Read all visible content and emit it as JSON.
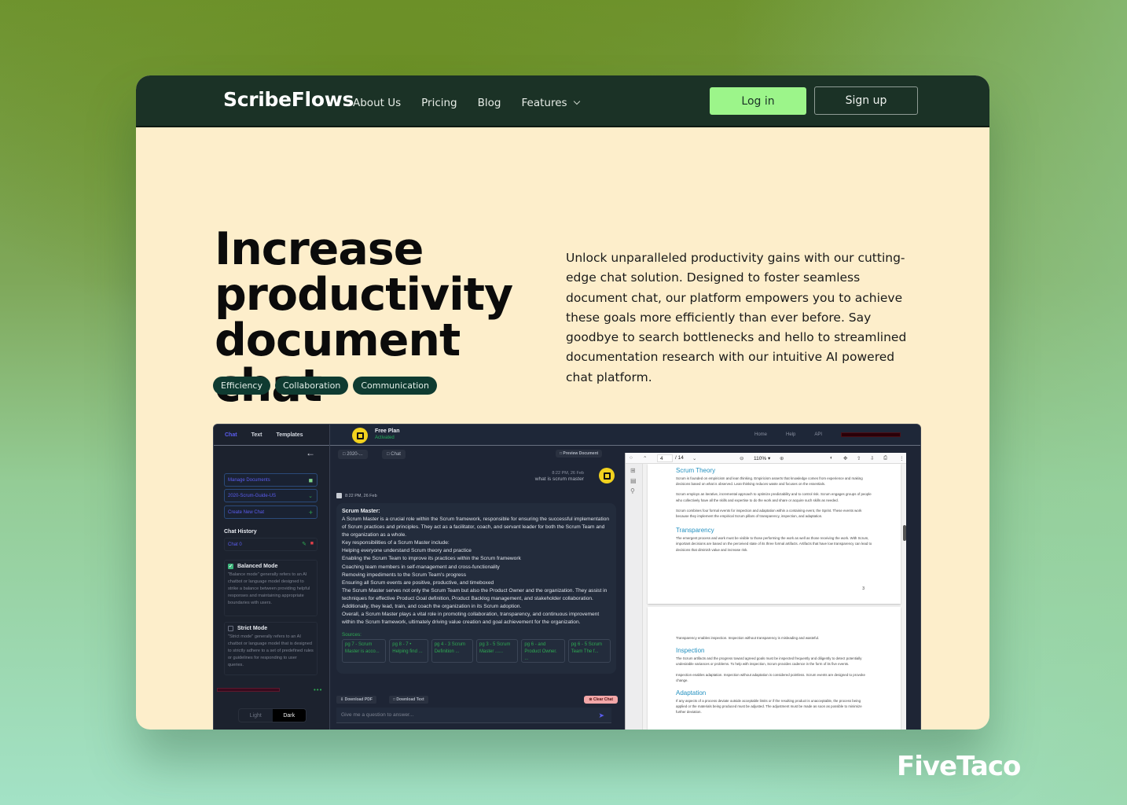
{
  "nav": {
    "logo": "ScribeFlows",
    "links": [
      "About Us",
      "Pricing",
      "Blog",
      "Features"
    ],
    "login": "Log in",
    "signup": "Sign up"
  },
  "hero": {
    "title_lines": [
      "Increase",
      "productivity",
      "document chat"
    ],
    "tags": [
      "Efficiency",
      "Collaboration",
      "Communication"
    ],
    "description": "Unlock unparalleled productivity gains with our cutting-edge chat solution. Designed to foster seamless document chat, our platform empowers you to achieve these goals more efficiently than ever before. Say goodbye to search bottlenecks and hello to streamlined documentation research with our intuitive AI powered chat platform."
  },
  "app": {
    "side_tabs": [
      "Chat",
      "Text",
      "Templates"
    ],
    "manage_documents": "Manage Documents",
    "selected_document": "2020-Scrum-Guide-US",
    "create_new_chat": "Create New Chat",
    "chat_history_title": "Chat History",
    "chat_items": [
      "Chat 0"
    ],
    "balanced_mode": {
      "title": "Balanced Mode",
      "checked": true,
      "text": "\"Balance mode\" generally refers to an AI chatbot or language model designed to strike a balance between providing helpful responses and maintaining appropriate boundaries with users."
    },
    "strict_mode": {
      "title": "Strict Mode",
      "checked": false,
      "text": "\"Strict mode\" generally refers to an AI chatbot or language model that is designed to strictly adhere to a set of predefined rules or guidelines for responding to user queries."
    },
    "theme_options": [
      "Light",
      "Dark"
    ],
    "theme_selected": "Dark",
    "plan_name": "Free Plan",
    "plan_status": "Activated",
    "top_links": [
      "Home",
      "Help",
      "API"
    ],
    "chips": [
      "2020-...",
      "Chat"
    ],
    "preview_document": "Preview Document",
    "user_message": {
      "time": "8:22 PM, 26 Feb",
      "text": "what is scrum master"
    },
    "bot_message": {
      "time": "8:22 PM, 26 Feb",
      "title": "Scrum Master:",
      "lines": [
        "A Scrum Master is a crucial role within the Scrum framework, responsible for ensuring the successful implementation of Scrum practices and principles. They act as a facilitator, coach, and servant leader for both the Scrum Team and the organization as a whole.",
        "Key responsibilities of a Scrum Master include:",
        "Helping everyone understand Scrum theory and practice",
        "Enabling the Scrum Team to improve its practices within the Scrum framework",
        "Coaching team members in self-management and cross-functionality",
        "Removing impediments to the Scrum Team's progress",
        "Ensuring all Scrum events are positive, productive, and timeboxed",
        "The Scrum Master serves not only the Scrum Team but also the Product Owner and the organization. They assist in techniques for effective Product Goal definition, Product Backlog management, and stakeholder collaboration. Additionally, they lead, train, and coach the organization in its Scrum adoption.",
        "Overall, a Scrum Master plays a vital role in promoting collaboration, transparency, and continuous improvement within the Scrum framework, ultimately driving value creation and goal achievement for the organization."
      ],
      "sources_label": "Sources:",
      "sources": [
        "pg 7 - Scrum Master is acco...",
        "pg 8 - 7 • Helping find ...",
        "pg 4 - 3 Scrum Definition ...",
        "pg 3 - 5 Scrum Master ......",
        "pg 6 - and Product Owner. ...",
        "pg 6 - 5 Scrum Team The f..."
      ]
    },
    "download_pdf": "Download PDF",
    "download_text": "Download Text",
    "clear_chat": "Clear Chat",
    "input_placeholder": "Give me a question to answer...",
    "pdf": {
      "current_page": "4",
      "total_pages": "/ 14",
      "zoom": "110% ▾",
      "page1": {
        "heading": "Scrum Theory",
        "paras": [
          "Scrum is founded on empiricism and lean thinking. Empiricism asserts that knowledge comes from experience and making decisions based on what is observed. Lean thinking reduces waste and focuses on the essentials.",
          "Scrum employs an iterative, incremental approach to optimize predictability and to control risk. Scrum engages groups of people who collectively have all the skills and expertise to do the work and share or acquire such skills as needed.",
          "Scrum combines four formal events for inspection and adaptation within a containing event, the Sprint. These events work because they implement the empirical Scrum pillars of transparency, inspection, and adaptation."
        ],
        "heading2": "Transparency",
        "para2": "The emergent process and work must be visible to those performing the work as well as those receiving the work. With Scrum, important decisions are based on the perceived state of its three formal artifacts. Artifacts that have low transparency can lead to decisions that diminish value and increase risk.",
        "page_number": "3"
      },
      "page2": {
        "intro": "Transparency enables inspection. Inspection without transparency is misleading and wasteful.",
        "heading": "Inspection",
        "para": "The Scrum artifacts and the progress toward agreed goals must be inspected frequently and diligently to detect potentially undesirable variances or problems. To help with inspection, Scrum provides cadence in the form of its five events.",
        "para2": "Inspection enables adaptation. Inspection without adaptation is considered pointless. Scrum events are designed to provoke change.",
        "heading2": "Adaptation",
        "para3": "If any aspects of a process deviate outside acceptable limits or if the resulting product is unacceptable, the process being applied or the materials being produced must be adjusted. The adjustment must be made as soon as possible to minimize further deviation."
      }
    }
  },
  "watermark": "FiveTaco",
  "colors": {
    "nav_bg": "#1b3226",
    "login_bg": "#9cf58a",
    "hero_bg": "#fdeecb",
    "tag_bg": "#0f3b31",
    "app_accent": "#5b5df0"
  }
}
